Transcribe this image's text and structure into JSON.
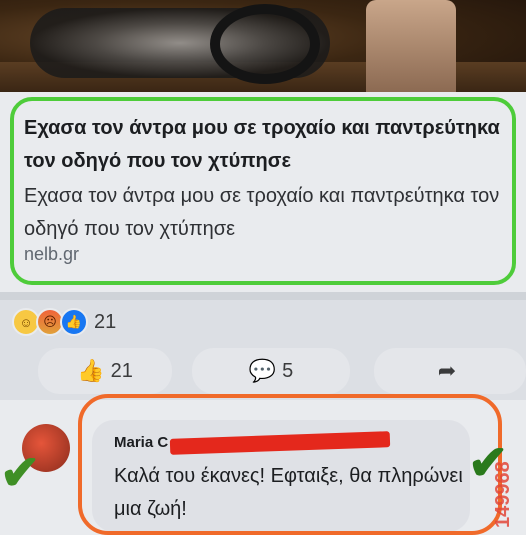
{
  "link": {
    "title": "Εχασα τον άντρα μου σε τροχαίο και παντρεύτηκα τον οδηγό που τον χτύπησε",
    "description": "Εχασα τον άντρα μου σε τροχαίο και παντρεύτηκα τον οδηγό που τον χτύπησε",
    "domain": "nelb.gr"
  },
  "reactions": {
    "count": "21",
    "types": [
      "haha",
      "angry",
      "like"
    ]
  },
  "actions": {
    "like_count": "21",
    "comment_count": "5"
  },
  "comment": {
    "author": "Maria C",
    "text": "Καλά του έκανες! Εφταιξε, θα πληρώνει μια ζωή!"
  },
  "annotations": {
    "watermark": "149968",
    "ring_colors": {
      "top": "#4ecc3a",
      "bottom": "#f06a2a"
    }
  },
  "icons": [
    "thumbs-up-icon",
    "comment-icon",
    "share-icon",
    "checkmark-icon"
  ]
}
